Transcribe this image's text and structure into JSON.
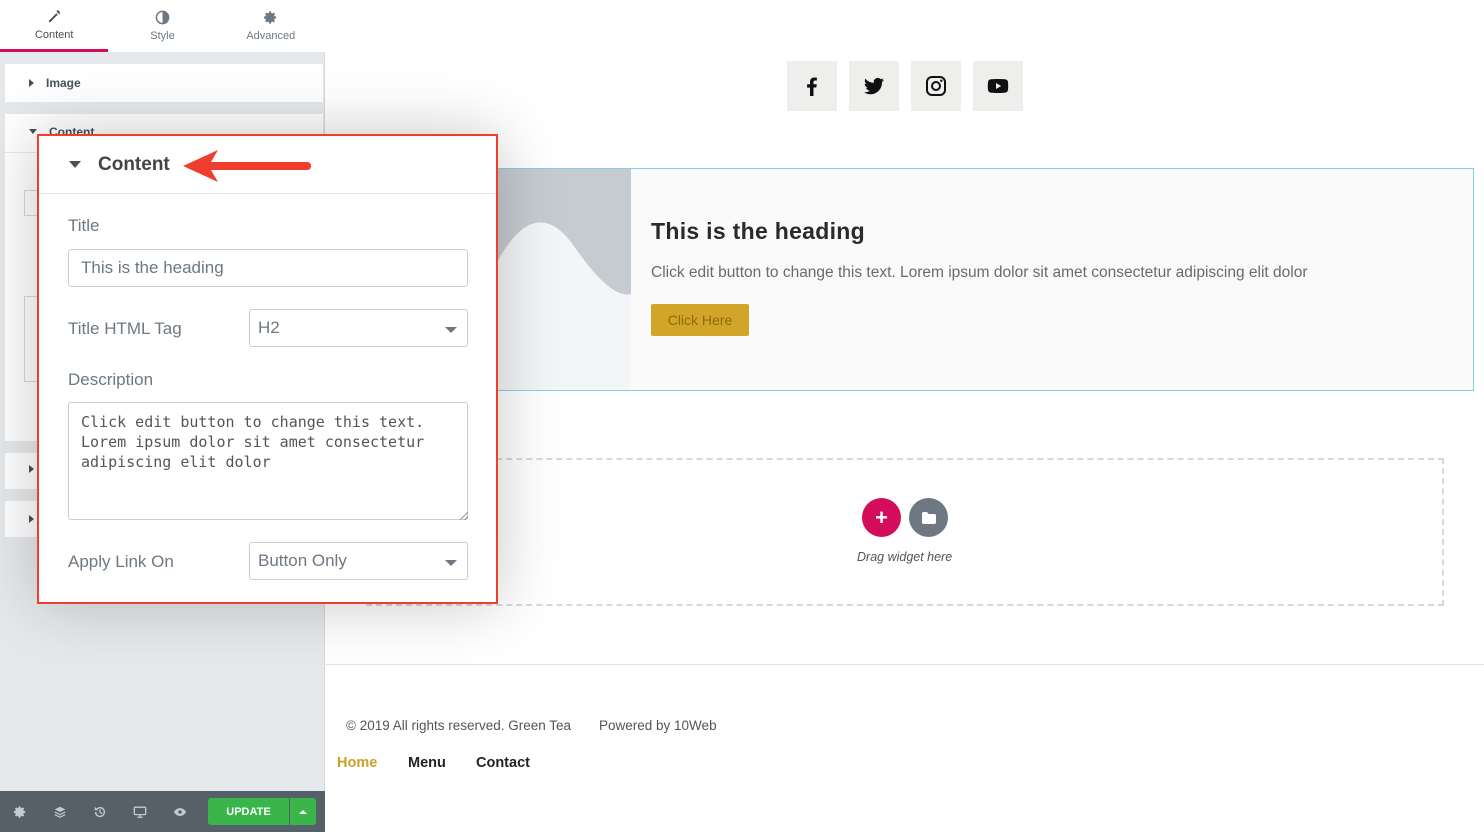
{
  "panel": {
    "tabs": [
      {
        "label": "Content",
        "icon": "pencil-icon",
        "active": true
      },
      {
        "label": "Style",
        "icon": "contrast-icon",
        "active": false
      },
      {
        "label": "Advanced",
        "icon": "gear-icon",
        "active": false
      }
    ],
    "sections": {
      "image": "Image",
      "content": "Content"
    },
    "bottom": {
      "icons": [
        "settings-icon",
        "layers-icon",
        "history-icon",
        "responsive-icon",
        "preview-icon"
      ],
      "update_label": "UPDATE"
    }
  },
  "callout": {
    "title": "Content",
    "title_label": "Title",
    "title_value": "This is the heading",
    "tag_label": "Title HTML Tag",
    "tag_value": "H2",
    "description_label": "Description",
    "description_value": "Click edit button to change this text.\nLorem ipsum dolor sit amet consectetur\nadipiscing elit dolor",
    "link_label": "Apply Link On",
    "link_value": "Button Only",
    "accent_color": "#ef3e2e"
  },
  "preview": {
    "social_icons": [
      "facebook-icon",
      "twitter-icon",
      "instagram-icon",
      "youtube-icon"
    ],
    "cta": {
      "heading": "This is the heading",
      "description": "Click edit button to change this text. Lorem ipsum dolor sit amet consectetur adipiscing elit dolor",
      "button": "Click Here",
      "button_color": "#d2a529"
    },
    "drop_zone": {
      "text": "Drag widget here"
    },
    "footer": {
      "copyright": "© 2019 All rights reserved. Green Tea",
      "powered": "Powered by 10Web",
      "nav": [
        "Home",
        "Menu",
        "Contact"
      ]
    }
  }
}
